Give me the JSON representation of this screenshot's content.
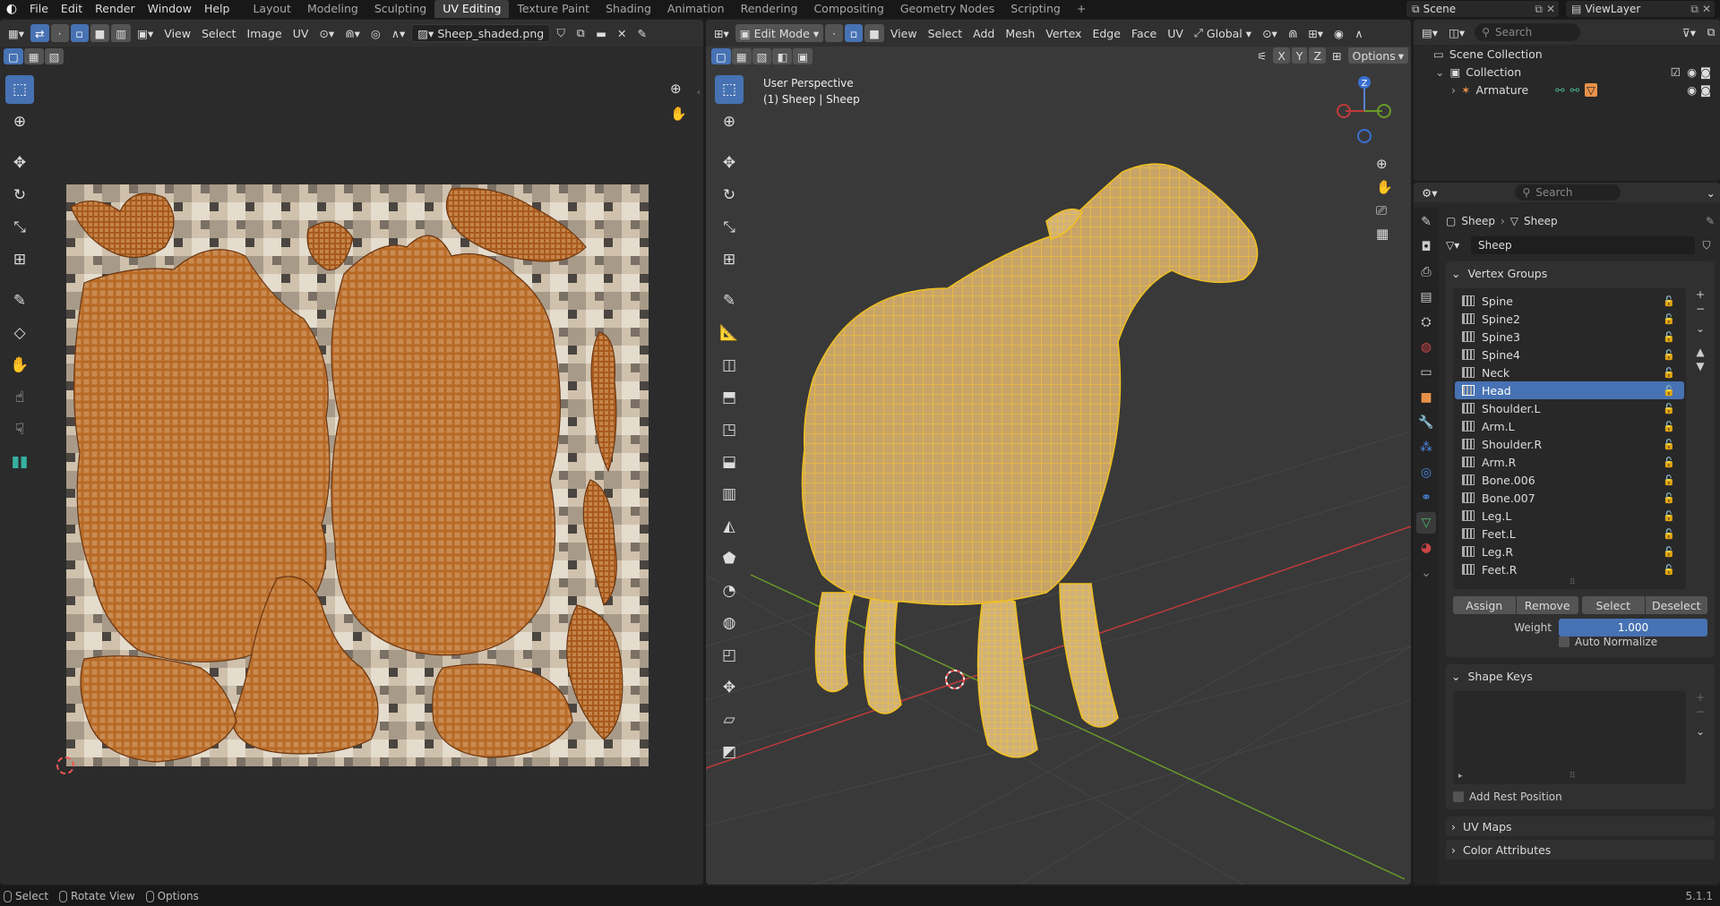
{
  "topbar": {
    "menus": [
      "File",
      "Edit",
      "Render",
      "Window",
      "Help"
    ],
    "workspaces": [
      "Layout",
      "Modeling",
      "Sculpting",
      "UV Editing",
      "Texture Paint",
      "Shading",
      "Animation",
      "Rendering",
      "Compositing",
      "Geometry Nodes",
      "Scripting"
    ],
    "active_workspace": "UV Editing",
    "add_tab": "+",
    "scene": "Scene",
    "view_layer": "ViewLayer"
  },
  "uv_editor": {
    "menus": [
      "View",
      "Select",
      "Image",
      "UV"
    ],
    "image_name": "Sheep_shaded.png",
    "tools": [
      "select-box-icon",
      "cursor-icon",
      "move-icon",
      "rotate-icon",
      "scale-icon",
      "transform-icon",
      "annotate-icon",
      "rip-icon",
      "grab-icon",
      "relax-icon",
      "pinch-icon",
      "sample-icon"
    ]
  },
  "viewport": {
    "mode": "Edit Mode",
    "menus": [
      "View",
      "Select",
      "Add",
      "Mesh",
      "Vertex",
      "Edge",
      "Face",
      "UV"
    ],
    "transform_orientation": "Global",
    "axes": [
      "X",
      "Y",
      "Z"
    ],
    "options_label": "Options",
    "overlay_line1": "User Perspective",
    "overlay_line2": "(1) Sheep | Sheep",
    "gizmo_axis_label": "Z"
  },
  "outliner": {
    "search_placeholder": "Search",
    "scene_collection": "Scene Collection",
    "collection": "Collection",
    "armature": "Armature"
  },
  "properties": {
    "search_placeholder": "Search",
    "breadcrumb_object": "Sheep",
    "breadcrumb_data": "Sheep",
    "mesh_name": "Sheep",
    "vertex_groups_title": "Vertex Groups",
    "vertex_groups": [
      "Spine",
      "Spine2",
      "Spine3",
      "Spine4",
      "Neck",
      "Head",
      "Shoulder.L",
      "Arm.L",
      "Shoulder.R",
      "Arm.R",
      "Bone.006",
      "Bone.007",
      "Leg.L",
      "Feet.L",
      "Leg.R",
      "Feet.R"
    ],
    "selected_group": "Head",
    "assign": "Assign",
    "remove": "Remove",
    "select": "Select",
    "deselect": "Deselect",
    "weight_label": "Weight",
    "weight_value": "1.000",
    "auto_normalize": "Auto Normalize",
    "shape_keys_title": "Shape Keys",
    "add_rest_position": "Add Rest Position",
    "uv_maps_title": "UV Maps",
    "color_attributes_title": "Color Attributes"
  },
  "statusbar": {
    "select": "Select",
    "rotate_view": "Rotate View",
    "options": "Options",
    "version": "5.1.1"
  },
  "colors": {
    "accent": "#4772b3",
    "mesh_wire": "#e8b830",
    "uv_orange": "#b86a26",
    "x_axis": "#c03a3a",
    "y_axis": "#6a9a2a"
  }
}
